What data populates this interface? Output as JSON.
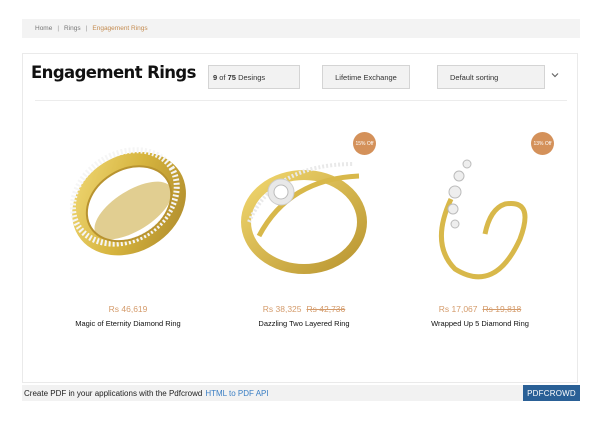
{
  "breadcrumb": {
    "home": "Home",
    "rings": "Rings",
    "current": "Engagement Rings",
    "separator": "|"
  },
  "header": {
    "title": "Engagement Rings",
    "count_shown": "9",
    "count_of": "of",
    "count_total": "75",
    "count_suffix": "Desings",
    "exchange_label": "Lifetime Exchange",
    "sort_selected": "Default sorting"
  },
  "products": [
    {
      "name": "Magic of Eternity Diamond Ring",
      "price": "Rs 46,619",
      "old_price": "",
      "badge": ""
    },
    {
      "name": "Dazzling Two Layered Ring",
      "price": "Rs 38,325",
      "old_price": "Rs 42,736",
      "badge": "15% Off"
    },
    {
      "name": "Wrapped Up 5 Diamond Ring",
      "price": "Rs 17,067",
      "old_price": "Rs 19,818",
      "badge": "13% Off"
    }
  ],
  "pdf_bar": {
    "text": "Create PDF in your applications with the Pdfcrowd",
    "link": "HTML to PDF API",
    "button": "PDFCROWD"
  },
  "colors": {
    "accent": "#c48b4f",
    "badge": "#d4915a",
    "price": "#d49b6b",
    "gold": "#d8b84a",
    "pdf_button": "#2a6096",
    "link": "#3b7fc4"
  },
  "icons": {
    "sort_toggle": "chevron-down-icon"
  }
}
